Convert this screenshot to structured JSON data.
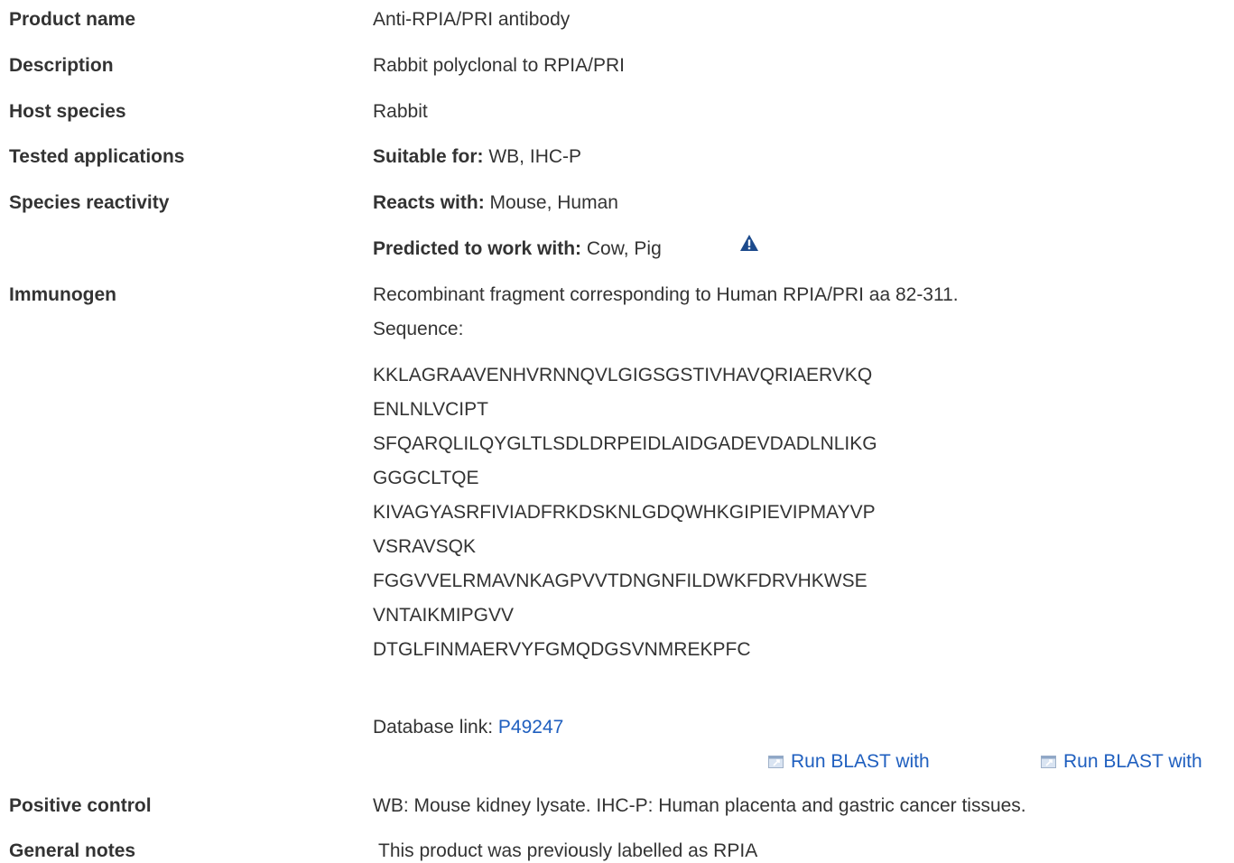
{
  "rows": {
    "product_name": {
      "label": "Product name",
      "value": "Anti-RPIA/PRI antibody"
    },
    "description": {
      "label": "Description",
      "value": "Rabbit polyclonal to RPIA/PRI"
    },
    "host_species": {
      "label": "Host species",
      "value": "Rabbit"
    },
    "tested_applications": {
      "label": "Tested applications",
      "prefix": "Suitable for:",
      "value": "WB, IHC-P"
    },
    "species_reactivity": {
      "label": "Species reactivity",
      "reacts_prefix": "Reacts with:",
      "reacts_value": "Mouse, Human",
      "predicted_prefix": "Predicted to work with:",
      "predicted_value": "Cow, Pig",
      "warning_icon": "warning-triangle-icon"
    },
    "immunogen": {
      "label": "Immunogen",
      "line1": "Recombinant fragment corresponding to Human RPIA/PRI aa 82-311.",
      "sequence_label": "Sequence:",
      "sequence_lines": [
        "KKLAGRAAVENHVRNNQVLGIGSGSTIVHAVQRIAERVKQ",
        "ENLNLVCIPT",
        "SFQARQLILQYGLTLSDLDRPEIDLAIDGADEVDADLNLIKG",
        "GGGCLTQE",
        "KIVAGYASRFIVIADFRKDSKNLGDQWHKGIPIEVIPMAYVP",
        "VSRAVSQK",
        "FGGVVELRMAVNKAGPVVTDNGNFILDWKFDRVHKWSE",
        "VNTAIKMIPGVV",
        "DTGLFINMAERVYFGMQDGSVNMREKPFC"
      ],
      "database_prefix": "Database link:",
      "database_link": "P49247",
      "blast_links": [
        "Run BLAST with",
        "Run BLAST with"
      ],
      "blast_icon": "external-link-icon"
    },
    "positive_control": {
      "label": "Positive control",
      "value": "WB: Mouse kidney lysate. IHC-P: Human placenta and gastric cancer tissues."
    },
    "general_notes": {
      "label": "General notes",
      "value": "This product was previously labelled as RPIA"
    }
  },
  "colors": {
    "text": "#333333",
    "link": "#1f5fbf",
    "warning": "#1c4a8c"
  }
}
